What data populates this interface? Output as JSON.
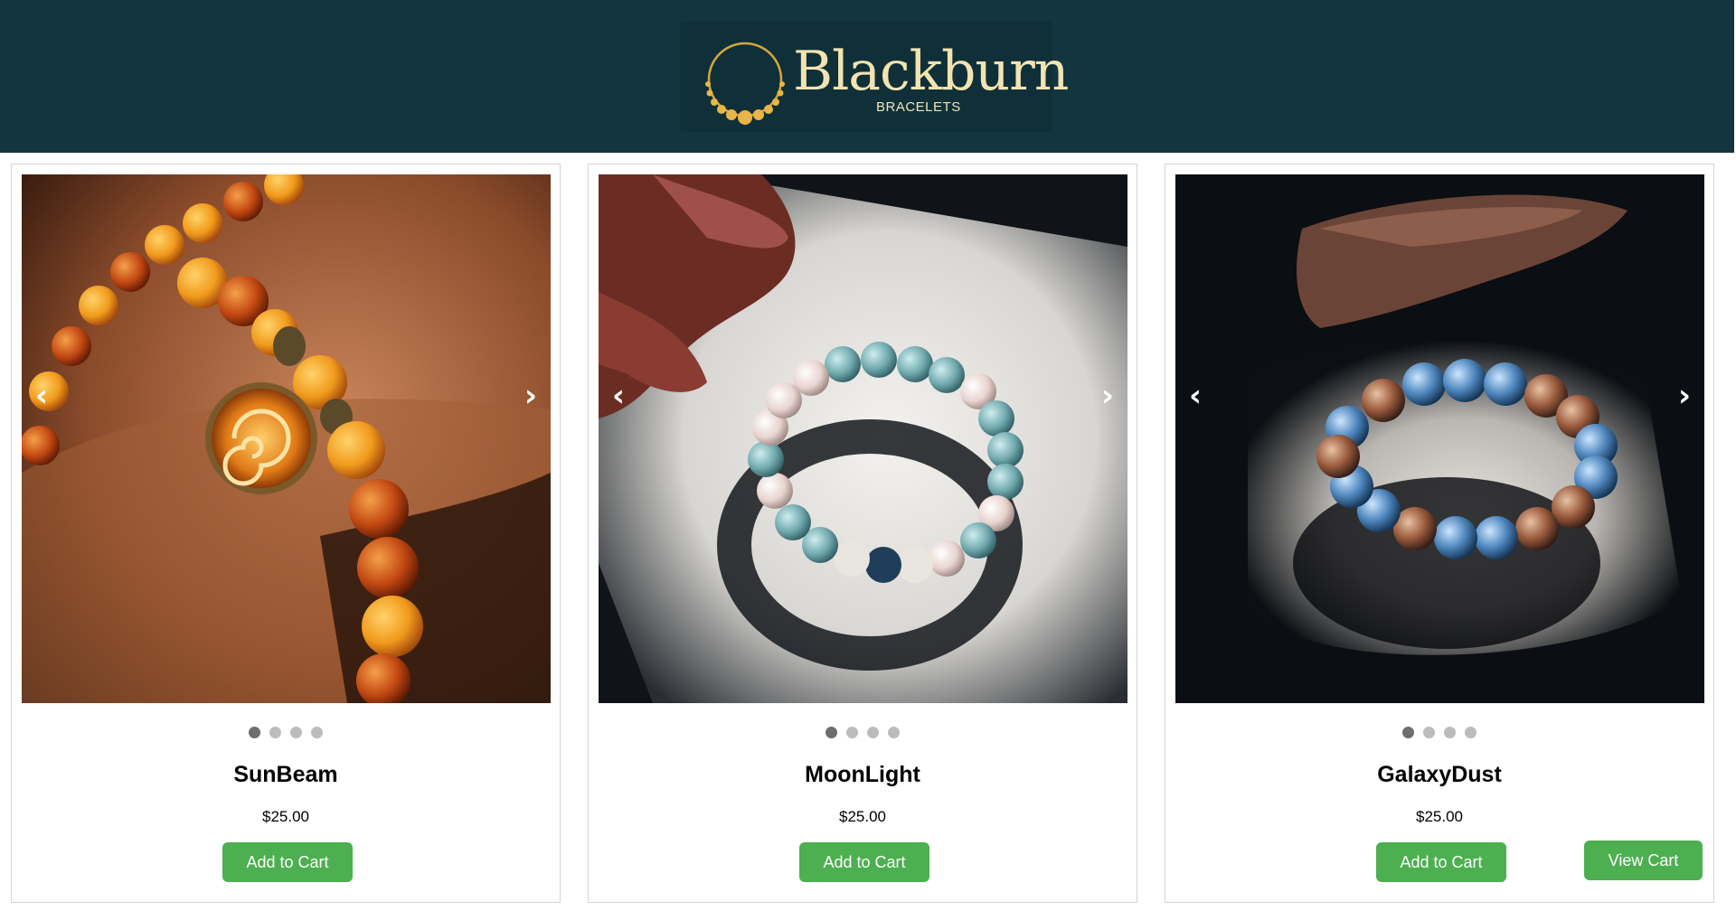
{
  "header": {
    "brand_name": "Blackburn",
    "brand_sub": "BRACELETS",
    "background": "#13353f",
    "logo_color": "#f2e3b0"
  },
  "products": [
    {
      "name": "SunBeam",
      "price": "$25.00",
      "add_label": "Add to Cart",
      "prev": "‹",
      "next": "›",
      "image_dots": 4,
      "active_dot": 1
    },
    {
      "name": "MoonLight",
      "price": "$25.00",
      "add_label": "Add to Cart",
      "prev": "‹",
      "next": "›",
      "image_dots": 4,
      "active_dot": 1
    },
    {
      "name": "GalaxyDust",
      "price": "$25.00",
      "add_label": "Add to Cart",
      "prev": "‹",
      "next": "›",
      "image_dots": 4,
      "active_dot": 1
    }
  ],
  "cart": {
    "view_label": "View Cart"
  },
  "colors": {
    "button": "#4caf50",
    "dot_active": "#6e6e6e",
    "dot_inactive": "#bcbcbc"
  }
}
